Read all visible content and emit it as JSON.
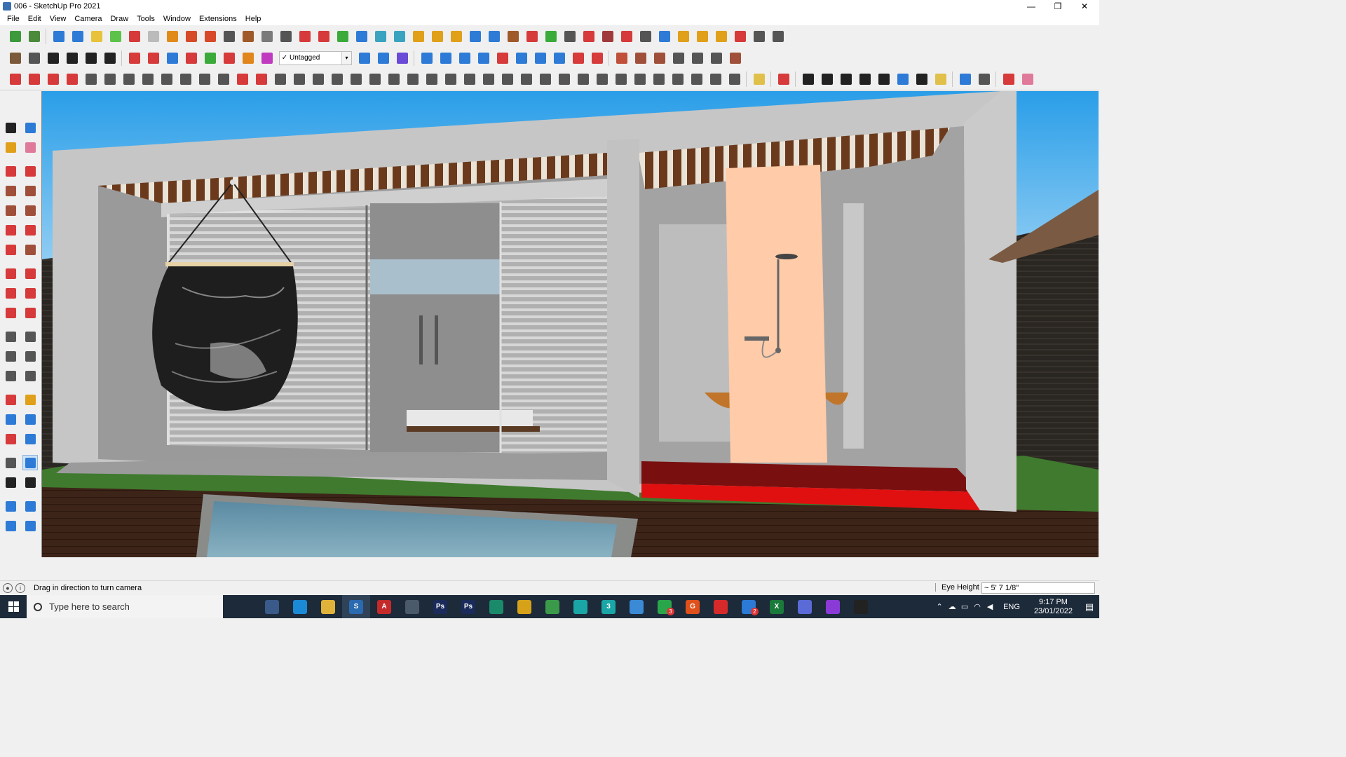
{
  "window": {
    "title": "006 - SketchUp Pro 2021",
    "controls": {
      "minimize": "—",
      "restore": "❐",
      "close": "✕"
    }
  },
  "menu": [
    "File",
    "Edit",
    "View",
    "Camera",
    "Draw",
    "Tools",
    "Window",
    "Extensions",
    "Help"
  ],
  "toolbar": {
    "tag_select": {
      "check": "✓",
      "value": "Untagged",
      "arrow": "▾"
    },
    "row1_icons": [
      {
        "name": "sketchup-logo-icon",
        "color": "#3c9a3c"
      },
      {
        "name": "3d-warehouse-icon",
        "color": "#4a8a3a"
      },
      {
        "name": "sep"
      },
      {
        "name": "iso-view-icon",
        "color": "#2d7bd6"
      },
      {
        "name": "top-view-icon",
        "color": "#2d7bd6"
      },
      {
        "name": "front-view-icon",
        "color": "#e8c23a"
      },
      {
        "name": "right-view-icon",
        "color": "#5cc24a"
      },
      {
        "name": "back-view-icon",
        "color": "#d63a3a"
      },
      {
        "name": "left-view-icon",
        "color": "#bbbbbb"
      },
      {
        "name": "follow-me-icon",
        "color": "#e08a1a"
      },
      {
        "name": "section-plane-icon",
        "color": "#d64a2a"
      },
      {
        "name": "section-fill-icon",
        "color": "#d64a2a"
      },
      {
        "name": "tape-icon",
        "color": "#555555"
      },
      {
        "name": "paint-icon",
        "color": "#a05a2a"
      },
      {
        "name": "pipe-icon",
        "color": "#7a7a7a"
      },
      {
        "name": "curve-icon",
        "color": "#555555"
      },
      {
        "name": "spline-icon",
        "color": "#d63a3a"
      },
      {
        "name": "axis-red-icon",
        "color": "#d63a3a"
      },
      {
        "name": "axis-green-icon",
        "color": "#3aab3a"
      },
      {
        "name": "axis-blue-icon",
        "color": "#2d7bd6"
      },
      {
        "name": "cone-icon",
        "color": "#3aa4c0"
      },
      {
        "name": "cone2-icon",
        "color": "#3aa4c0"
      },
      {
        "name": "triangle-icon",
        "color": "#e0a01a"
      },
      {
        "name": "lasso-icon",
        "color": "#e0a01a"
      },
      {
        "name": "rotate-icon",
        "color": "#e0a01a"
      },
      {
        "name": "orbit-tool-icon",
        "color": "#2d7bd6"
      },
      {
        "name": "target-icon",
        "color": "#2d7bd6"
      },
      {
        "name": "bucket-icon",
        "color": "#a05a2a"
      },
      {
        "name": "undo-red-icon",
        "color": "#d63a3a"
      },
      {
        "name": "plugin-green-icon",
        "color": "#3aab3a"
      },
      {
        "name": "puzzle-icon",
        "color": "#555555"
      },
      {
        "name": "puzzle2-icon",
        "color": "#d63a3a"
      },
      {
        "name": "puzzle3-icon",
        "color": "#a03a3a"
      },
      {
        "name": "ruby-icon",
        "color": "#d63a3a"
      },
      {
        "name": "grid-icon",
        "color": "#555555"
      },
      {
        "name": "panel-icon",
        "color": "#2d7bd6"
      },
      {
        "name": "tile-icon",
        "color": "#e0a01a"
      },
      {
        "name": "tile2-icon",
        "color": "#e0a01a"
      },
      {
        "name": "tile3-icon",
        "color": "#e0a01a"
      },
      {
        "name": "scatter-icon",
        "color": "#d63a3a"
      },
      {
        "name": "circle-dash-icon",
        "color": "#555555"
      },
      {
        "name": "layout-icon",
        "color": "#555555"
      }
    ],
    "row2_icons": [
      {
        "name": "box-icon",
        "color": "#7a5a3a"
      },
      {
        "name": "book-icon",
        "color": "#555555"
      },
      {
        "name": "home-icon",
        "color": "#222222"
      },
      {
        "name": "house-icon",
        "color": "#222222"
      },
      {
        "name": "house2-icon",
        "color": "#222222"
      },
      {
        "name": "house3-icon",
        "color": "#222222"
      },
      {
        "name": "sep"
      },
      {
        "name": "push-pull-icon",
        "color": "#d63a3a"
      },
      {
        "name": "move-red-icon",
        "color": "#d63a3a"
      },
      {
        "name": "move-blue-icon",
        "color": "#2d7bd6"
      },
      {
        "name": "rotate-r-icon",
        "color": "#d63a3a"
      },
      {
        "name": "scale-v-icon",
        "color": "#3aab3a"
      },
      {
        "name": "move-n-icon",
        "color": "#d63a3a"
      },
      {
        "name": "move-x-icon",
        "color": "#e0861a"
      },
      {
        "name": "move-f-icon",
        "color": "#c03ac0"
      },
      {
        "name": "tag-select"
      },
      {
        "name": "section-blue-icon",
        "color": "#2d7bd6"
      },
      {
        "name": "section-blue2-icon",
        "color": "#2d7bd6"
      },
      {
        "name": "section-blue3-icon",
        "color": "#6a4ad6"
      },
      {
        "name": "sep"
      },
      {
        "name": "component-icon",
        "color": "#2d7bd6"
      },
      {
        "name": "component2-icon",
        "color": "#2d7bd6"
      },
      {
        "name": "extrude-icon",
        "color": "#2d7bd6"
      },
      {
        "name": "arrows-up-icon",
        "color": "#2d7bd6"
      },
      {
        "name": "arrows-down-icon",
        "color": "#d63a3a"
      },
      {
        "name": "dimension-icon",
        "color": "#2d7bd6"
      },
      {
        "name": "hourglass-icon",
        "color": "#2d7bd6"
      },
      {
        "name": "undo-blue-icon",
        "color": "#2d7bd6"
      },
      {
        "name": "redo-red-icon",
        "color": "#d63a3a"
      },
      {
        "name": "hand-icon",
        "color": "#d63a3a"
      },
      {
        "name": "sep"
      },
      {
        "name": "curve-wall-icon",
        "color": "#c0503a"
      },
      {
        "name": "grid-roof-icon",
        "color": "#a0503a"
      },
      {
        "name": "roof-icon",
        "color": "#a0503a"
      },
      {
        "name": "roof2-icon",
        "color": "#555555"
      },
      {
        "name": "stairs-icon",
        "color": "#555555"
      },
      {
        "name": "frame-icon",
        "color": "#555555"
      },
      {
        "name": "diagonal-icon",
        "color": "#a0503a"
      }
    ],
    "row3_icons": [
      {
        "name": "bezier-icon",
        "color": "#d63a3a"
      },
      {
        "name": "bezier2-icon",
        "color": "#d63a3a"
      },
      {
        "name": "bezier3-icon",
        "color": "#d63a3a"
      },
      {
        "name": "scissors-icon",
        "color": "#d63a3a"
      },
      {
        "name": "gear-icon",
        "color": "#555555"
      },
      {
        "name": "shape-icon",
        "color": "#555555"
      },
      {
        "name": "hook-icon",
        "color": "#555555"
      },
      {
        "name": "loft-icon",
        "color": "#555555"
      },
      {
        "name": "sphere-icon",
        "color": "#555555"
      },
      {
        "name": "sweep-icon",
        "color": "#555555"
      },
      {
        "name": "fillet-icon",
        "color": "#555555"
      },
      {
        "name": "fillet2-icon",
        "color": "#555555"
      },
      {
        "name": "line-red-icon",
        "color": "#d63a3a"
      },
      {
        "name": "curve-red-icon",
        "color": "#d63a3a"
      },
      {
        "name": "cylinder-icon",
        "color": "#555555"
      },
      {
        "name": "pen-icon",
        "color": "#555555"
      },
      {
        "name": "comb-icon",
        "color": "#555555"
      },
      {
        "name": "rib-icon",
        "color": "#555555"
      },
      {
        "name": "palm-icon",
        "color": "#555555"
      },
      {
        "name": "leaf-icon",
        "color": "#555555"
      },
      {
        "name": "leaf2-icon",
        "color": "#555555"
      },
      {
        "name": "layers-icon",
        "color": "#555555"
      },
      {
        "name": "blade-icon",
        "color": "#555555"
      },
      {
        "name": "blade2-icon",
        "color": "#555555"
      },
      {
        "name": "blade3-icon",
        "color": "#555555"
      },
      {
        "name": "blade4-icon",
        "color": "#555555"
      },
      {
        "name": "cup-icon",
        "color": "#555555"
      },
      {
        "name": "ribbon-icon",
        "color": "#555555"
      },
      {
        "name": "cube-icon",
        "color": "#555555"
      },
      {
        "name": "stamp-icon",
        "color": "#555555"
      },
      {
        "name": "stack-icon",
        "color": "#555555"
      },
      {
        "name": "hatch-icon",
        "color": "#555555"
      },
      {
        "name": "hatch2-icon",
        "color": "#555555"
      },
      {
        "name": "comb2-icon",
        "color": "#555555"
      },
      {
        "name": "fan-icon",
        "color": "#555555"
      },
      {
        "name": "fan2-icon",
        "color": "#555555"
      },
      {
        "name": "diag-icon",
        "color": "#555555"
      },
      {
        "name": "stripes-icon",
        "color": "#555555"
      },
      {
        "name": "diamond-icon",
        "color": "#555555"
      },
      {
        "name": "sep"
      },
      {
        "name": "tag-yellow-icon",
        "color": "#e0c04a"
      },
      {
        "name": "sep"
      },
      {
        "name": "knife-icon",
        "color": "#d63a3a"
      },
      {
        "name": "sep"
      },
      {
        "name": "rect-draw-icon",
        "color": "#222222"
      },
      {
        "name": "circle-draw-icon",
        "color": "#222222"
      },
      {
        "name": "hexagon-draw-icon",
        "color": "#222222"
      },
      {
        "name": "ellipse-draw-icon",
        "color": "#222222"
      },
      {
        "name": "parallelogram-draw-icon",
        "color": "#222222"
      },
      {
        "name": "arc-draw-icon",
        "color": "#2d7bd6"
      },
      {
        "name": "gear-draw-icon",
        "color": "#222222"
      },
      {
        "name": "star-draw-icon",
        "color": "#e0c04a"
      },
      {
        "name": "sep"
      },
      {
        "name": "poly-blue-icon",
        "color": "#2d7bd6"
      },
      {
        "name": "spiral-icon",
        "color": "#555555"
      },
      {
        "name": "sep"
      },
      {
        "name": "extrude-red-icon",
        "color": "#d63a3a"
      },
      {
        "name": "eraser-pink-icon",
        "color": "#e07a9a"
      }
    ]
  },
  "left_tools": [
    [
      {
        "name": "select-tool-icon",
        "color": "#222222"
      },
      {
        "name": "component-tool-icon",
        "color": "#2d7bd6"
      }
    ],
    [
      {
        "name": "paint-bucket-tool-icon",
        "color": "#e0a01a"
      },
      {
        "name": "eraser-tool-icon",
        "color": "#e07a9a"
      }
    ],
    "gap",
    [
      {
        "name": "line-tool-icon",
        "color": "#d63a3a"
      },
      {
        "name": "freehand-tool-icon",
        "color": "#d63a3a"
      }
    ],
    [
      {
        "name": "rectangle-tool-icon",
        "color": "#a0503a"
      },
      {
        "name": "rotated-rect-tool-icon",
        "color": "#a0503a"
      }
    ],
    [
      {
        "name": "circle-tool-icon",
        "color": "#a0503a"
      },
      {
        "name": "polygon-tool-icon",
        "color": "#a0503a"
      }
    ],
    [
      {
        "name": "arc-tool-icon",
        "color": "#d63a3a"
      },
      {
        "name": "arc2-tool-icon",
        "color": "#d63a3a"
      }
    ],
    [
      {
        "name": "arc3-tool-icon",
        "color": "#d63a3a"
      },
      {
        "name": "pie-tool-icon",
        "color": "#a0503a"
      }
    ],
    "gap",
    [
      {
        "name": "move-tool-icon",
        "color": "#d63a3a"
      },
      {
        "name": "push-pull-tool-icon",
        "color": "#d63a3a"
      }
    ],
    [
      {
        "name": "rotate-tool-icon",
        "color": "#d63a3a"
      },
      {
        "name": "follow-me-tool-icon",
        "color": "#d63a3a"
      }
    ],
    [
      {
        "name": "scale-tool-icon",
        "color": "#d63a3a"
      },
      {
        "name": "offset-tool-icon",
        "color": "#d63a3a"
      }
    ],
    "gap",
    [
      {
        "name": "tape-measure-tool-icon",
        "color": "#555555"
      },
      {
        "name": "dimension-tool-icon",
        "color": "#555555"
      }
    ],
    [
      {
        "name": "protractor-tool-icon",
        "color": "#555555"
      },
      {
        "name": "text-tool-icon",
        "color": "#555555"
      }
    ],
    [
      {
        "name": "axes-tool-icon",
        "color": "#555555"
      },
      {
        "name": "3d-text-tool-icon",
        "color": "#555555"
      }
    ],
    "gap",
    [
      {
        "name": "orbit-tool-icon",
        "color": "#d63a3a"
      },
      {
        "name": "pan-tool-icon",
        "color": "#e0a01a"
      }
    ],
    [
      {
        "name": "zoom-tool-icon",
        "color": "#2d7bd6"
      },
      {
        "name": "zoom-window-tool-icon",
        "color": "#2d7bd6"
      }
    ],
    [
      {
        "name": "zoom-extents-tool-icon",
        "color": "#d63a3a"
      },
      {
        "name": "zoom-previous-tool-icon",
        "color": "#2d7bd6"
      }
    ],
    "gap",
    [
      {
        "name": "position-camera-tool-icon",
        "color": "#555555"
      },
      {
        "name": "look-around-tool-icon",
        "color": "#2d7bd6",
        "active": true
      }
    ],
    [
      {
        "name": "walk-tool-icon",
        "color": "#222222"
      },
      {
        "name": "section-plane-tool-icon",
        "color": "#222222"
      }
    ],
    "gap",
    [
      {
        "name": "sandbox-tool-icon",
        "color": "#2d7bd6"
      },
      {
        "name": "sandbox-smoove-tool-icon",
        "color": "#2d7bd6"
      }
    ],
    [
      {
        "name": "sandbox-stamp-tool-icon",
        "color": "#2d7bd6"
      },
      {
        "name": "sandbox-drape-tool-icon",
        "color": "#2d7bd6"
      }
    ]
  ],
  "status": {
    "message": "Drag in direction to turn camera",
    "vcb_label": "Eye Height",
    "vcb_value": "~ 5' 7 1/8\""
  },
  "taskbar": {
    "search_placeholder": "Type here to search",
    "apps": [
      {
        "name": "task-view-icon",
        "color": "#1c2a3a",
        "label": ""
      },
      {
        "name": "calculator-icon",
        "color": "#3a5a8a",
        "label": ""
      },
      {
        "name": "edge-icon",
        "color": "#1a8ad6",
        "label": ""
      },
      {
        "name": "file-explorer-icon",
        "color": "#e0b23a",
        "label": ""
      },
      {
        "name": "sketchup-taskbar-icon",
        "color": "#2a6ab0",
        "label": "S",
        "active": true
      },
      {
        "name": "acrobat-icon",
        "color": "#c42a2a",
        "label": "A"
      },
      {
        "name": "snip-icon",
        "color": "#4a5a6a",
        "label": ""
      },
      {
        "name": "photoshop-icon",
        "color": "#1a2a5a",
        "label": "Ps"
      },
      {
        "name": "photoshop2-icon",
        "color": "#1a2a5a",
        "label": "Ps"
      },
      {
        "name": "maps-icon",
        "color": "#1a8a6a",
        "label": ""
      },
      {
        "name": "chrome-icon",
        "color": "#d6a21a",
        "label": ""
      },
      {
        "name": "chrome2-icon",
        "color": "#3a9a4a",
        "label": ""
      },
      {
        "name": "app-teal-icon",
        "color": "#1aa6a6",
        "label": ""
      },
      {
        "name": "app-3-icon",
        "color": "#1aa6a6",
        "label": "3"
      },
      {
        "name": "app-blue-icon",
        "color": "#3a8ad6",
        "label": ""
      },
      {
        "name": "whatsapp-icon",
        "color": "#2aa64a",
        "label": "",
        "badge": "3"
      },
      {
        "name": "grammarly-icon",
        "color": "#e0501a",
        "label": "G"
      },
      {
        "name": "opera-icon",
        "color": "#d62a2a",
        "label": ""
      },
      {
        "name": "todo-icon",
        "color": "#2a7ad6",
        "label": "",
        "badge": "2"
      },
      {
        "name": "excel-icon",
        "color": "#1a7a3a",
        "label": "X"
      },
      {
        "name": "discord-icon",
        "color": "#5a6ad6",
        "label": ""
      },
      {
        "name": "podcast-icon",
        "color": "#8a3ad6",
        "label": ""
      },
      {
        "name": "terminal-icon",
        "color": "#222222",
        "label": ""
      }
    ],
    "tray": {
      "lang": "ENG",
      "time": "9:17 PM",
      "date": "23/01/2022"
    }
  }
}
